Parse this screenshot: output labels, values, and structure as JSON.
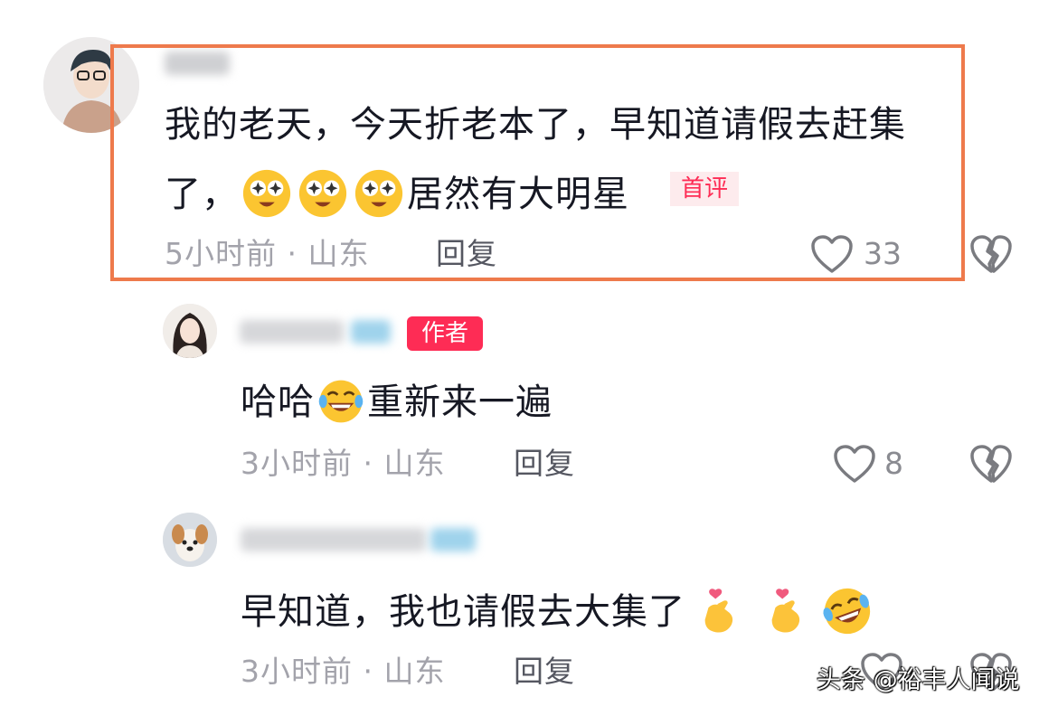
{
  "comments": [
    {
      "text_line1": "我的老天，今天折老本了，早知道请假去赶集",
      "text_line2_prefix": "了，",
      "text_line2_suffix": "居然有大明星",
      "badge": "首评",
      "time_location": "5小时前 · 山东",
      "reply_label": "回复",
      "likes": "33",
      "emoji_name": "star-eyes-emoji"
    },
    {
      "badge": "作者",
      "text_prefix": "哈哈",
      "text_suffix": "重新来一遍",
      "time_location": "3小时前 · 山东",
      "reply_label": "回复",
      "likes": "8",
      "emoji_name": "laughing-tears-emoji"
    },
    {
      "text": "早知道，我也请假去大集了",
      "time_location": "3小时前 · 山东",
      "reply_label": "回复",
      "emoji_names": [
        "finger-heart-emoji",
        "finger-heart-emoji",
        "rolling-laugh-emoji"
      ]
    }
  ],
  "watermark": "头条 @裕丰人闻说",
  "colors": {
    "highlight_border": "#ee7a4c",
    "accent_red": "#fe2c55",
    "meta_gray": "#a3a3ab",
    "text": "#161823"
  },
  "icons": {
    "like": "heart-outline-icon",
    "dislike": "broken-heart-icon"
  }
}
